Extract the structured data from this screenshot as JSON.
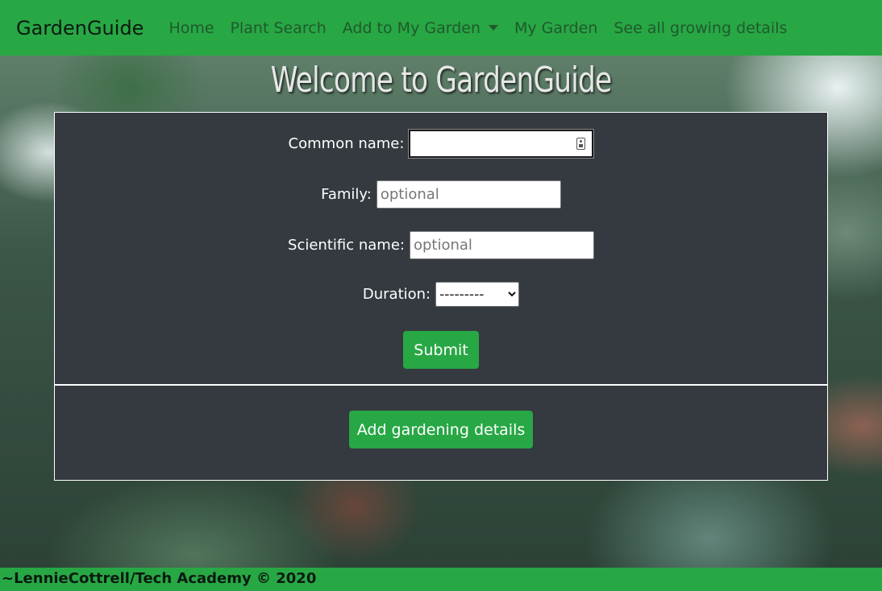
{
  "nav": {
    "brand": "GardenGuide",
    "links": [
      "Home",
      "Plant Search",
      "Add to My Garden",
      "My Garden",
      "See all growing details"
    ]
  },
  "hero": {
    "title": "Welcome to GardenGuide"
  },
  "form": {
    "common_name_label": "Common name:",
    "common_name_value": "",
    "family_label": "Family:",
    "family_placeholder": "optional",
    "scientific_label": "Scientific name:",
    "scientific_placeholder": "optional",
    "duration_label": "Duration:",
    "duration_selected": "---------",
    "submit_label": "Submit"
  },
  "actions": {
    "add_details_label": "Add gardening details"
  },
  "footer": {
    "text": "~LennieCottrell/Tech Academy © 2020"
  },
  "colors": {
    "brand_green": "#28a745",
    "panel_dark": "#343a40"
  }
}
